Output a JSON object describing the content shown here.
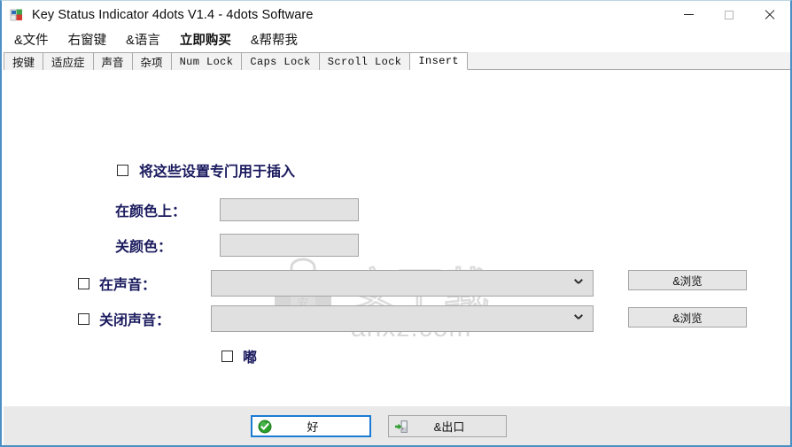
{
  "window": {
    "title": "Key Status Indicator 4dots V1.4 - 4dots Software",
    "app_icon": "app-logo-icon",
    "controls": {
      "minimize": "minimize-icon",
      "maximize": "maximize-icon",
      "close": "close-icon"
    },
    "accent_border": "#4a90c4"
  },
  "menu": {
    "items": [
      {
        "label": "&文件",
        "bold": false
      },
      {
        "label": "右窗键",
        "bold": false
      },
      {
        "label": "&语言",
        "bold": false
      },
      {
        "label": "立即购买",
        "bold": true
      },
      {
        "label": "&帮帮我",
        "bold": false
      }
    ]
  },
  "tabs": {
    "items": [
      {
        "label": "按键",
        "mono": false,
        "active": false
      },
      {
        "label": "适应症",
        "mono": false,
        "active": false
      },
      {
        "label": "声音",
        "mono": false,
        "active": false
      },
      {
        "label": "杂项",
        "mono": false,
        "active": false
      },
      {
        "label": "Num Lock",
        "mono": true,
        "active": false
      },
      {
        "label": "Caps Lock",
        "mono": true,
        "active": false
      },
      {
        "label": "Scroll Lock",
        "mono": true,
        "active": false
      },
      {
        "label": "Insert",
        "mono": true,
        "active": true
      }
    ],
    "active_label": "Insert"
  },
  "panel": {
    "dedicated_checkbox": {
      "label": "将这些设置专门用于插入",
      "checked": false
    },
    "color_on": {
      "label": "在颜色上：",
      "value": ""
    },
    "color_off": {
      "label": "关颜色：",
      "value": ""
    },
    "sound_on": {
      "label": "在声音：",
      "checked": false,
      "value": "",
      "browse_label": "&浏览"
    },
    "sound_off": {
      "label": "关闭声音：",
      "checked": false,
      "value": "",
      "browse_label": "&浏览"
    },
    "beep": {
      "label": "嘟",
      "checked": false
    },
    "label_color": "#1a1a5e"
  },
  "watermark": {
    "site_text": "anxz.com",
    "chars": "安下载"
  },
  "footer": {
    "ok_button": {
      "label": "好",
      "icon": "green-check-icon",
      "focused": true
    },
    "exit_button": {
      "label": "&出口",
      "icon": "exit-door-icon"
    }
  }
}
